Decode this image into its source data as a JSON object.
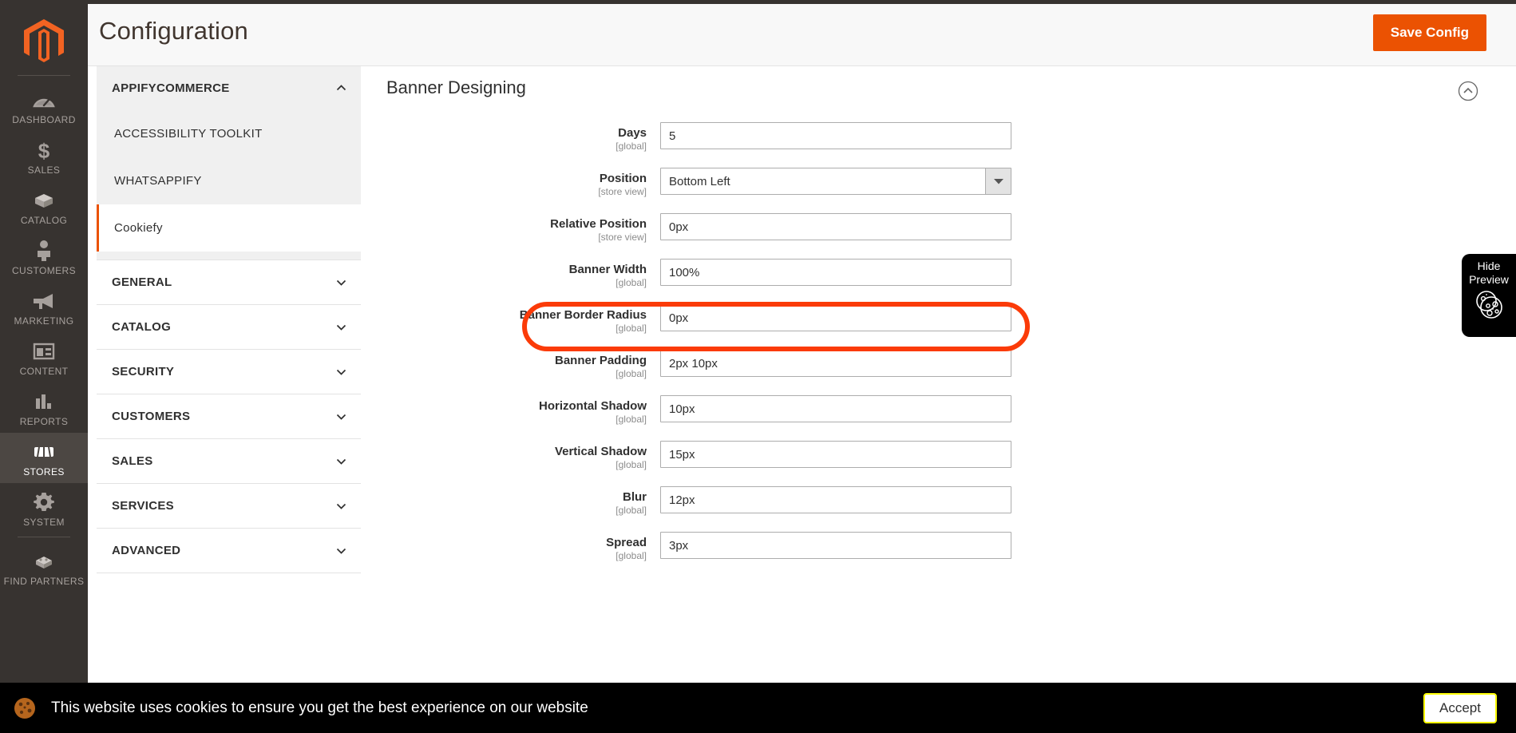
{
  "admin_nav": {
    "logo_name": "magento-logo",
    "items": [
      {
        "label": "DASHBOARD",
        "icon": "dashboard-icon",
        "active": false
      },
      {
        "label": "SALES",
        "icon": "dollar-icon",
        "active": false
      },
      {
        "label": "CATALOG",
        "icon": "box-icon",
        "active": false
      },
      {
        "label": "CUSTOMERS",
        "icon": "person-icon",
        "active": false
      },
      {
        "label": "MARKETING",
        "icon": "megaphone-icon",
        "active": false
      },
      {
        "label": "CONTENT",
        "icon": "layout-icon",
        "active": false
      },
      {
        "label": "REPORTS",
        "icon": "bar-chart-icon",
        "active": false
      },
      {
        "label": "STORES",
        "icon": "storefront-icon",
        "active": true
      },
      {
        "label": "SYSTEM",
        "icon": "gear-icon",
        "active": false
      },
      {
        "label": "FIND PARTNERS",
        "icon": "puzzle-icon",
        "active": false
      }
    ]
  },
  "header": {
    "title": "Configuration",
    "save_label": "Save Config"
  },
  "config_tree": {
    "appify": {
      "label": "APPIFYCOMMERCE",
      "expanded": true,
      "children": [
        {
          "label": "ACCESSIBILITY TOOLKIT",
          "active": false
        },
        {
          "label": "WHATSAPPIFY",
          "active": false
        },
        {
          "label": "Cookiefy",
          "active": true
        }
      ]
    },
    "sections": [
      {
        "label": "GENERAL"
      },
      {
        "label": "CATALOG"
      },
      {
        "label": "SECURITY"
      },
      {
        "label": "CUSTOMERS"
      },
      {
        "label": "SALES"
      },
      {
        "label": "SERVICES"
      },
      {
        "label": "ADVANCED"
      }
    ]
  },
  "main": {
    "section_title": "Banner Designing",
    "collapse_icon": "chevron-up-circle-icon",
    "fields": [
      {
        "name": "Days",
        "scope": "[global]",
        "value": "5",
        "type": "text"
      },
      {
        "name": "Position",
        "scope": "[store view]",
        "value": "Bottom Left",
        "type": "select"
      },
      {
        "name": "Relative Position",
        "scope": "[store view]",
        "value": "0px",
        "type": "text"
      },
      {
        "name": "Banner Width",
        "scope": "[global]",
        "value": "100%",
        "type": "text"
      },
      {
        "name": "Banner Border Radius",
        "scope": "[global]",
        "value": "0px",
        "type": "text",
        "highlighted": true
      },
      {
        "name": "Banner Padding",
        "scope": "[global]",
        "value": "2px 10px",
        "type": "text"
      },
      {
        "name": "Horizontal Shadow",
        "scope": "[global]",
        "value": "10px",
        "type": "text"
      },
      {
        "name": "Vertical Shadow",
        "scope": "[global]",
        "value": "15px",
        "type": "text"
      },
      {
        "name": "Blur",
        "scope": "[global]",
        "value": "12px",
        "type": "text"
      },
      {
        "name": "Spread",
        "scope": "[global]",
        "value": "3px",
        "type": "text"
      }
    ]
  },
  "preview_toggle": {
    "line1": "Hide",
    "line2": "Preview",
    "icon": "cookie-icon"
  },
  "cookie_banner": {
    "icon": "cookie-icon",
    "message": "This website uses cookies to ensure you get the best experience on our website",
    "accept_label": "Accept"
  },
  "colors": {
    "accent_orange": "#eb5202",
    "nav_dark": "#373330",
    "annotation_red": "#fb3b08",
    "accept_border_yellow": "#ffff00"
  }
}
